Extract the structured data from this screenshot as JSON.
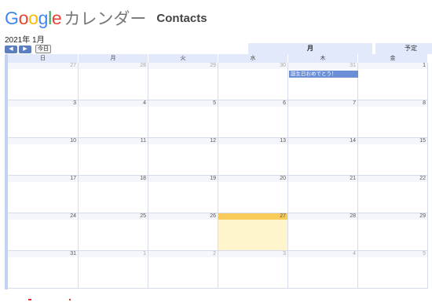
{
  "header": {
    "logo_letters": [
      {
        "ch": "G",
        "color": "#4285F4"
      },
      {
        "ch": "o",
        "color": "#EA4335"
      },
      {
        "ch": "o",
        "color": "#FBBC05"
      },
      {
        "ch": "g",
        "color": "#4285F4"
      },
      {
        "ch": "l",
        "color": "#34A853"
      },
      {
        "ch": "e",
        "color": "#EA4335"
      }
    ],
    "calendar_word": "カレンダー",
    "title": "Contacts"
  },
  "month_label": "2021年 1月",
  "nav": {
    "prev": "◀",
    "next": "▶",
    "today": "今日"
  },
  "view_tabs": {
    "month": "月",
    "schedule": "予定"
  },
  "weekdays": [
    "日",
    "月",
    "火",
    "水",
    "木",
    "金"
  ],
  "weeks": [
    [
      {
        "d": "27",
        "other": true
      },
      {
        "d": "28",
        "other": true
      },
      {
        "d": "29",
        "other": true
      },
      {
        "d": "30",
        "other": true
      },
      {
        "d": "31",
        "other": true
      },
      {
        "d": "1"
      }
    ],
    [
      {
        "d": "3"
      },
      {
        "d": "4"
      },
      {
        "d": "5"
      },
      {
        "d": "6"
      },
      {
        "d": "7"
      },
      {
        "d": "8"
      }
    ],
    [
      {
        "d": "10"
      },
      {
        "d": "11"
      },
      {
        "d": "12"
      },
      {
        "d": "13"
      },
      {
        "d": "14"
      },
      {
        "d": "15"
      }
    ],
    [
      {
        "d": "17"
      },
      {
        "d": "18"
      },
      {
        "d": "19"
      },
      {
        "d": "20"
      },
      {
        "d": "21"
      },
      {
        "d": "22"
      }
    ],
    [
      {
        "d": "24"
      },
      {
        "d": "25"
      },
      {
        "d": "26"
      },
      {
        "d": "27",
        "today": true
      },
      {
        "d": "28"
      },
      {
        "d": "29"
      }
    ],
    [
      {
        "d": "31"
      },
      {
        "d": "1",
        "other": true
      },
      {
        "d": "2",
        "other": true
      },
      {
        "d": "3",
        "other": true
      },
      {
        "d": "4",
        "other": true
      },
      {
        "d": "5",
        "other": true
      }
    ]
  ],
  "event": {
    "label": "誕生日おめでとう！",
    "color": "#6b8ed6"
  },
  "colors": {
    "accent": "#5b7ec1",
    "header_bg": "#e2e9fb",
    "today_bg": "#fff5cc",
    "today_num": "#f7cc5b"
  }
}
